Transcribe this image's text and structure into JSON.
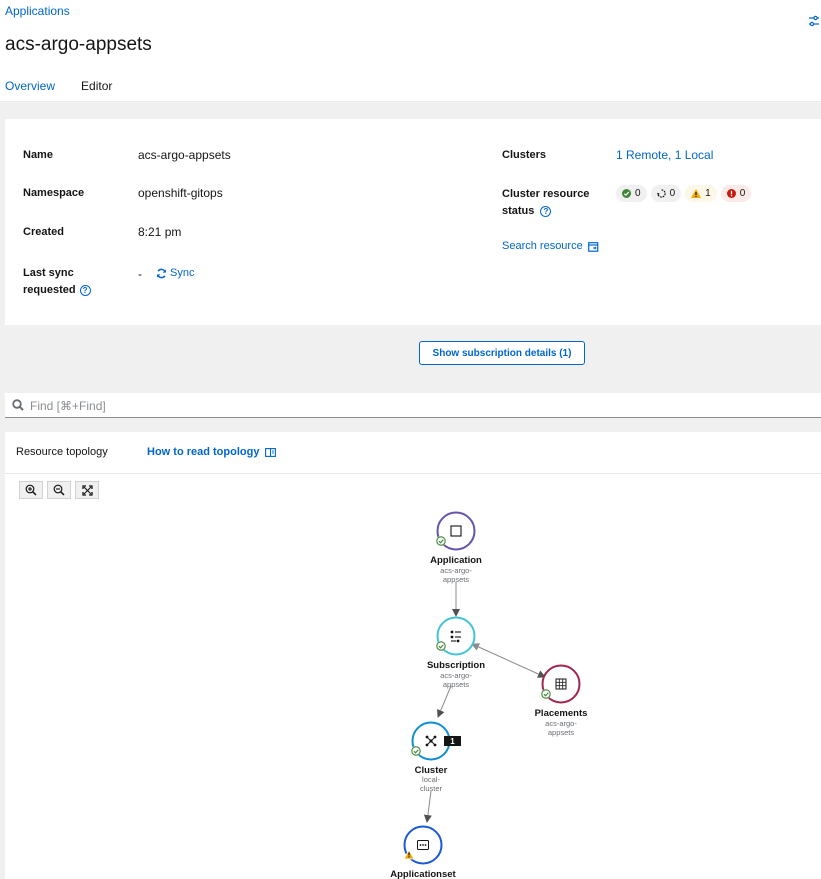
{
  "header": {
    "breadcrumb": "Applications",
    "title": "acs-argo-appsets",
    "settings_icon": "sliders-icon",
    "tabs": [
      {
        "label": "Overview",
        "active": true
      },
      {
        "label": "Editor",
        "active": false
      }
    ]
  },
  "overview": {
    "name_label": "Name",
    "name_value": "acs-argo-appsets",
    "namespace_label": "Namespace",
    "namespace_value": "openshift-gitops",
    "created_label": "Created",
    "created_value": "8:21 pm",
    "last_sync_label_1": "Last sync",
    "last_sync_label_2": "requested",
    "last_sync_value": "-",
    "sync_label": "Sync",
    "clusters_label": "Clusters",
    "clusters_value": "1 Remote, 1 Local",
    "status_label_1": "Cluster resource",
    "status_label_2": "status",
    "status_badges": {
      "healthy": "0",
      "pending": "0",
      "warning": "1",
      "error": "0"
    },
    "search_resource": "Search resource"
  },
  "subscription_button": "Show subscription details (1)",
  "search": {
    "placeholder": "Find [⌘+Find]"
  },
  "topology": {
    "title": "Resource topology",
    "how_to_read": "How to read topology",
    "nodes": [
      {
        "type": "Application",
        "name_1": "acs-argo-",
        "name_2": "appsets",
        "status": "ok",
        "color": "#6753ac"
      },
      {
        "type": "Subscription",
        "name_1": "acs-argo-",
        "name_2": "appsets",
        "status": "ok",
        "color": "#40c4d6"
      },
      {
        "type": "Placements",
        "name_1": "acs-argo-",
        "name_2": "appsets",
        "status": "ok",
        "color": "#a1254d"
      },
      {
        "type": "Cluster",
        "name_1": "local-",
        "name_2": "cluster",
        "status": "ok",
        "color": "#0f8ed1",
        "count": "1"
      },
      {
        "type": "Applicationset",
        "status": "warning",
        "color": "#1c5ad4"
      }
    ]
  },
  "colors": {
    "link": "#0066cc",
    "success": "#3e8635",
    "warning": "#f0ab00",
    "danger": "#c9190b"
  }
}
